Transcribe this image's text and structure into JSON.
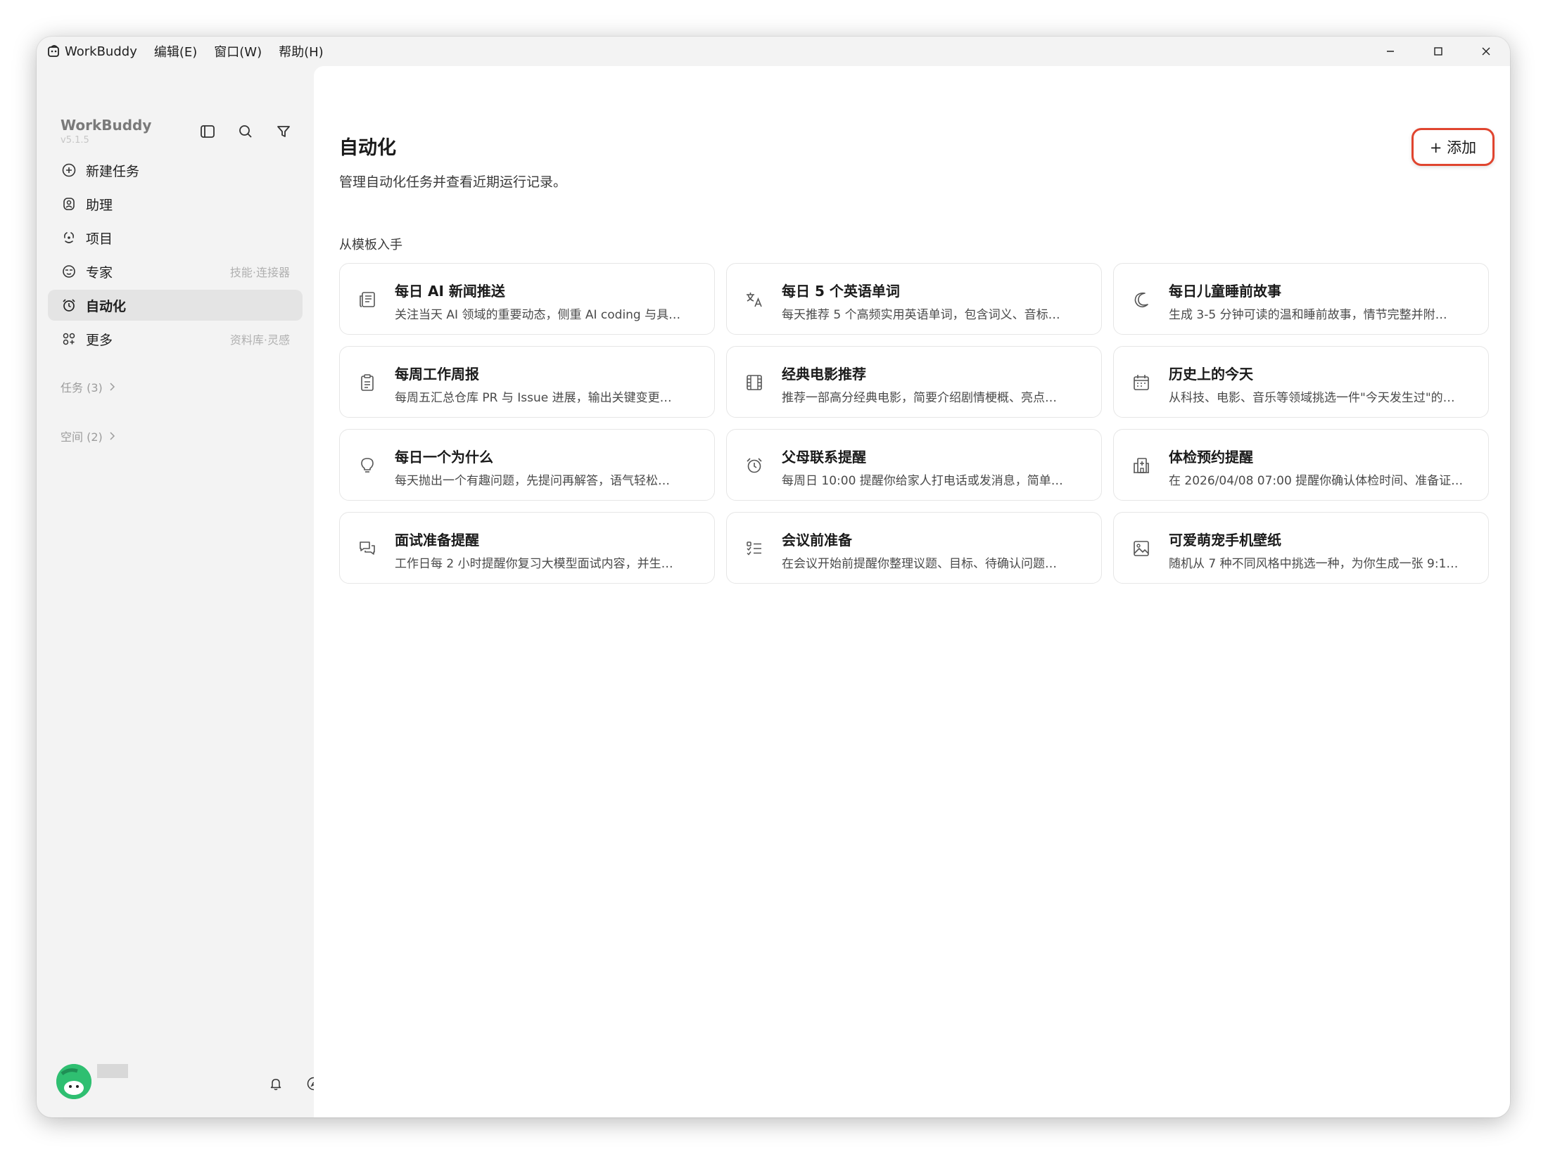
{
  "titlebar": {
    "app_name": "WorkBuddy",
    "menus": [
      "编辑(E)",
      "窗口(W)",
      "帮助(H)"
    ]
  },
  "sidebar": {
    "brand": "WorkBuddy",
    "version": "v5.1.5",
    "nav": [
      {
        "label": "新建任务",
        "icon": "plus-circle-icon",
        "hint": ""
      },
      {
        "label": "助理",
        "icon": "assistant-icon",
        "hint": ""
      },
      {
        "label": "项目",
        "icon": "project-icon",
        "hint": ""
      },
      {
        "label": "专家",
        "icon": "expert-icon",
        "hint": "技能·连接器"
      },
      {
        "label": "自动化",
        "icon": "alarm-icon",
        "hint": "",
        "active": true
      },
      {
        "label": "更多",
        "icon": "more-grid-icon",
        "hint": "资料库·灵感"
      }
    ],
    "groups": [
      {
        "label": "任务 (3)"
      },
      {
        "label": "空间 (2)"
      }
    ]
  },
  "main": {
    "title": "自动化",
    "subtitle": "管理自动化任务并查看近期运行记录。",
    "add_label": "+ 添加",
    "section_label": "从模板入手",
    "templates": [
      {
        "title": "每日 AI 新闻推送",
        "desc": "关注当天 AI 领域的重要动态，侧重 AI coding 与具…",
        "icon": "newspaper-icon"
      },
      {
        "title": "每日 5 个英语单词",
        "desc": "每天推荐 5 个高频实用英语单词，包含词义、音标…",
        "icon": "translate-icon"
      },
      {
        "title": "每日儿童睡前故事",
        "desc": "生成 3-5 分钟可读的温和睡前故事，情节完整并附…",
        "icon": "moon-icon"
      },
      {
        "title": "每周工作周报",
        "desc": "每周五汇总仓库 PR 与 Issue 进展，输出关键变更…",
        "icon": "clipboard-icon"
      },
      {
        "title": "经典电影推荐",
        "desc": "推荐一部高分经典电影，简要介绍剧情梗概、亮点…",
        "icon": "film-icon"
      },
      {
        "title": "历史上的今天",
        "desc": "从科技、电影、音乐等领域挑选一件\"今天发生过\"的…",
        "icon": "calendar-icon"
      },
      {
        "title": "每日一个为什么",
        "desc": "每天抛出一个有趣问题，先提问再解答，语气轻松…",
        "icon": "lightbulb-icon"
      },
      {
        "title": "父母联系提醒",
        "desc": "每周日 10:00 提醒你给家人打电话或发消息，简单…",
        "icon": "alarm-clock-icon"
      },
      {
        "title": "体检预约提醒",
        "desc": "在 2026/04/08 07:00 提醒你确认体检时间、准备证…",
        "icon": "hospital-icon"
      },
      {
        "title": "面试准备提醒",
        "desc": "工作日每 2 小时提醒你复习大模型面试内容，并生…",
        "icon": "chat-bubbles-icon"
      },
      {
        "title": "会议前准备",
        "desc": "在会议开始前提醒你整理议题、目标、待确认问题…",
        "icon": "checklist-icon"
      },
      {
        "title": "可爱萌宠手机壁纸",
        "desc": "随机从 7 种不同风格中挑选一种，为你生成一张 9:1…",
        "icon": "image-icon"
      }
    ]
  },
  "colors": {
    "accent_highlight": "#e0452f",
    "avatar": "#2fbf71"
  }
}
